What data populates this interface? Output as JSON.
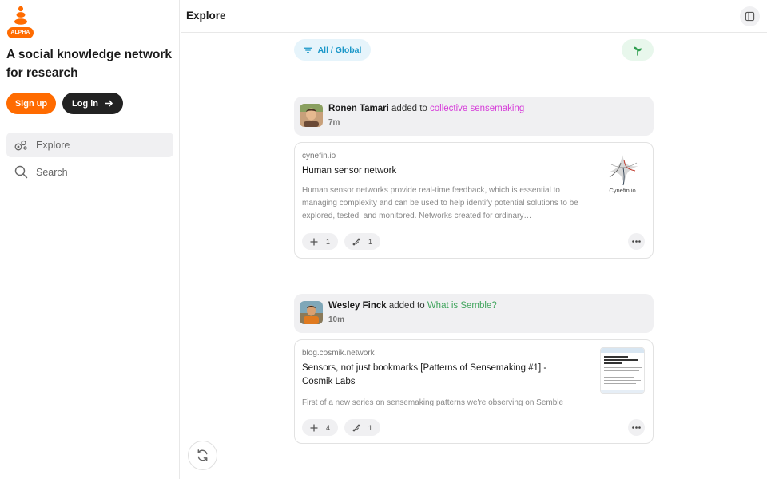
{
  "sidebar": {
    "badge": "ALPHA",
    "tagline": "A social knowledge network for research",
    "signup_label": "Sign up",
    "login_label": "Log in",
    "nav": [
      {
        "label": "Explore",
        "icon": "explore-icon",
        "active": true
      },
      {
        "label": "Search",
        "icon": "search-icon",
        "active": false
      }
    ]
  },
  "header": {
    "title": "Explore"
  },
  "filter": {
    "label": "All / Global"
  },
  "colors": {
    "brand": "#ff6b00",
    "filter_text": "#1a97c8",
    "pink_collection": "#d63bd9",
    "green_collection": "#3fa45c"
  },
  "feed": [
    {
      "user": "Ronen Tamari",
      "action": "added to",
      "collection": "collective sensemaking",
      "time": "7m",
      "card": {
        "domain": "cynefin.io",
        "title": "Human sensor network",
        "description": "Human sensor networks provide real-time feedback, which is essential to managing complexity and can be used to help identify potential solutions to be explored, tested, and monitored. Networks created for ordinary…",
        "thumb_text": "Cynefin.io",
        "add_count": "1",
        "connect_count": "1"
      }
    },
    {
      "user": "Wesley Finck",
      "action": "added to",
      "collection": "What is Semble?",
      "time": "10m",
      "card": {
        "domain": "blog.cosmik.network",
        "title": "Sensors, not just bookmarks [Patterns of Sensemaking #1] - Cosmik Labs",
        "description": "First of a new series on sensemaking patterns we're observing on Semble",
        "add_count": "4",
        "connect_count": "1"
      }
    }
  ]
}
